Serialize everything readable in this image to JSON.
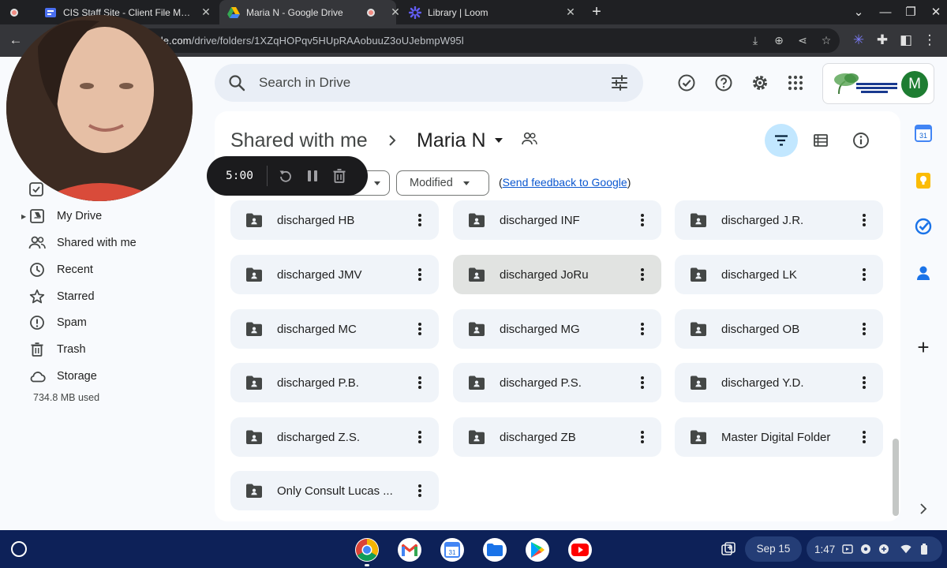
{
  "browser": {
    "tabs": [
      {
        "title": "",
        "kind": "recording"
      },
      {
        "title": "CIS Staff Site - Client File Materia",
        "kind": "sites"
      },
      {
        "title": "Maria N - Google Drive",
        "kind": "drive",
        "active": true
      },
      {
        "title": "",
        "kind": "recording"
      },
      {
        "title": "Library | Loom",
        "kind": "loom"
      }
    ],
    "url_host": "drive.google.com",
    "url_path": "/drive/folders/1XZqHOPqv5HUpRAAobuuZ3oUJebmpW95l"
  },
  "drive": {
    "search_placeholder": "Search in Drive",
    "nav": [
      {
        "label": "My Drive",
        "icon": "my-drive-icon"
      },
      {
        "label": "Shared with me",
        "icon": "people-icon"
      },
      {
        "label": "Recent",
        "icon": "clock-icon"
      },
      {
        "label": "Starred",
        "icon": "star-icon"
      },
      {
        "label": "Spam",
        "icon": "spam-icon"
      },
      {
        "label": "Trash",
        "icon": "trash-icon"
      },
      {
        "label": "Storage",
        "icon": "cloud-icon"
      }
    ],
    "storage_used": "734.8 MB used",
    "breadcrumb_root": "Shared with me",
    "breadcrumb_current": "Maria N",
    "chips": {
      "modified": "Modified"
    },
    "feedback_link": "Send feedback to Google",
    "folders": [
      {
        "name": "discharged HB"
      },
      {
        "name": "discharged INF"
      },
      {
        "name": "discharged J.R."
      },
      {
        "name": "discharged JMV"
      },
      {
        "name": "discharged JoRu",
        "selected": true
      },
      {
        "name": "discharged LK"
      },
      {
        "name": "discharged MC"
      },
      {
        "name": "discharged MG"
      },
      {
        "name": "discharged OB"
      },
      {
        "name": "discharged P.B."
      },
      {
        "name": "discharged P.S."
      },
      {
        "name": "discharged Y.D."
      },
      {
        "name": "discharged Z.S."
      },
      {
        "name": "discharged ZB"
      },
      {
        "name": "Master Digital Folder"
      },
      {
        "name": "Only Consult Lucas ..."
      }
    ],
    "account_initial": "M",
    "org_logo_lines": [
      "CONNECTIVE",
      "INTERVENTION",
      "SERVICES"
    ]
  },
  "loom": {
    "timer": "5:00"
  },
  "os": {
    "date": "Sep 15",
    "time": "1:47",
    "calendar_day": "31"
  },
  "colors": {
    "accent": "#0b57d0",
    "shelf": "#0d2158",
    "chrome_frame": "#1f2023",
    "selected_chip": "#c2e7ff"
  }
}
